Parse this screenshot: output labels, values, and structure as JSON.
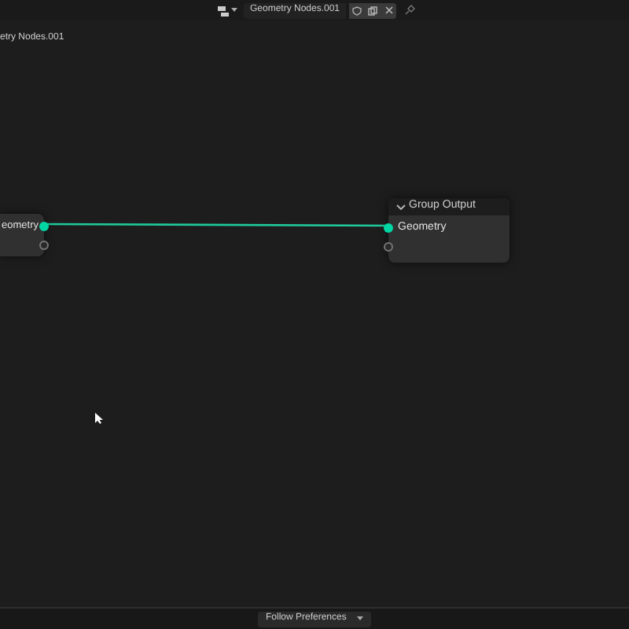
{
  "header": {
    "datablock_name": "Geometry Nodes.001",
    "fake_user": false
  },
  "breadcrumb": "etry Nodes.001",
  "nodes": [
    {
      "kind": "input",
      "socket": "eometry"
    },
    {
      "kind": "output",
      "title": "Group Output",
      "socket": "Geometry",
      "expanded": true
    }
  ],
  "footer": {
    "dropdown": "Follow Preferences"
  }
}
